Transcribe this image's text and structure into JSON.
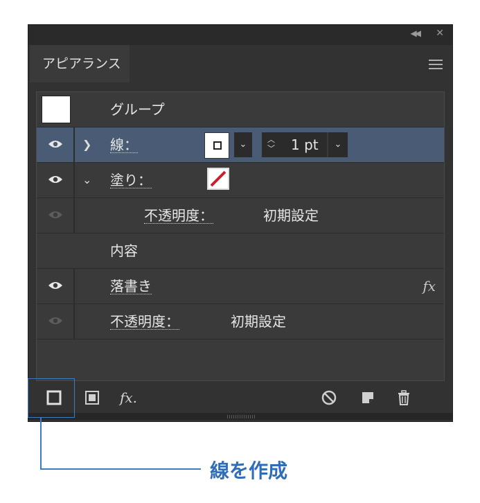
{
  "panel": {
    "tab_label": "アピアランス",
    "rows": {
      "group_label": "グループ",
      "stroke_label": "線：",
      "stroke_weight": "1 pt",
      "fill_label": "塗り：",
      "fill_opacity_label": "不透明度：",
      "fill_opacity_value": "初期設定",
      "contents_label": "内容",
      "scribble_label": "落書き",
      "fx_label": "fx",
      "opacity_label": "不透明度：",
      "opacity_value": "初期設定"
    },
    "bottom_toolbar": {
      "fx_label": "fx."
    }
  },
  "callout": {
    "text": "線を作成",
    "color": "#3b7bc4"
  },
  "colors": {
    "panel_bg": "#323232",
    "selected_row": "#4a5b75",
    "fill_swatch_slash": "#cc1f2d"
  }
}
